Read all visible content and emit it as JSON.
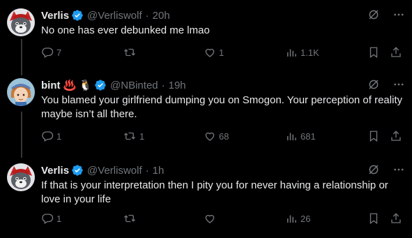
{
  "tweets": [
    {
      "name": "Verlis",
      "handle": "@Verliswolf",
      "time": "20h",
      "text": "No one has ever debunked me lmao",
      "emojis": "",
      "replies": "7",
      "retweets": "",
      "likes": "1",
      "views": "1.1K"
    },
    {
      "name": "bint",
      "handle": "@NBinted",
      "time": "19h",
      "text": "You blamed your girlfriend dumping you on Smogon. Your perception of reality maybe isn’t all there.",
      "emojis": "♨️ 🐧",
      "replies": "1",
      "retweets": "1",
      "likes": "68",
      "views": "681"
    },
    {
      "name": "Verlis",
      "handle": "@Verliswolf",
      "time": "1h",
      "text": "If that is your interpretation then I pity you for never having a relationship or love in your life",
      "emojis": "",
      "replies": "1",
      "retweets": "",
      "likes": "",
      "views": "26"
    }
  ],
  "separator": "·",
  "colors": {
    "background": "#000000",
    "text": "#e7e9ea",
    "muted": "#71767b",
    "verified": "#1d9bf0"
  },
  "icons": [
    "verified-badge-icon",
    "grok-slash-icon",
    "more-icon",
    "reply-icon",
    "retweet-icon",
    "like-icon",
    "views-icon",
    "bookmark-icon",
    "share-icon"
  ]
}
